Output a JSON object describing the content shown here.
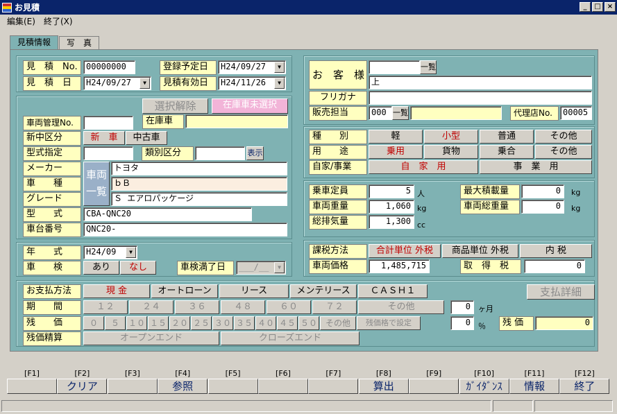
{
  "window": {
    "title": "お見積"
  },
  "menu": [
    "編集(E)",
    "終了(X)"
  ],
  "tabs": [
    "見積情報",
    "写　真"
  ],
  "header": {
    "no_label": "見　積　No.",
    "no_value": "00000000",
    "date_label": "見　積　日",
    "date_value": "H24/09/27",
    "reg_label": "登録予定日",
    "reg_value": "H24/09/27",
    "valid_label": "見積有効日",
    "valid_value": "H24/11/26"
  },
  "customer": {
    "name_label": "お　客　様",
    "name_value": "",
    "name2_value": "上",
    "kana_label": "フリガナ",
    "kana_value": "",
    "staff_label": "販売担当",
    "staff_code": "000",
    "staff_name": "",
    "agent_label": "代理店No.",
    "agent_value": "00005",
    "ichiran": "一覧"
  },
  "vehicle": {
    "clear_btn": "選択解除",
    "stock_btn": "在庫車未選択",
    "stock_label": "在庫車",
    "stock_value": "",
    "mgmt_label": "車両管理No.",
    "mgmt_value": "",
    "newold_label": "新中区分",
    "new_btn": "新　車",
    "used_btn": "中古車",
    "model_label": "型式指定",
    "model_value": "",
    "class_label": "類別区分",
    "class_value": "",
    "show_btn": "表示",
    "maker_label": "メーカー",
    "maker_value": "トヨタ",
    "car_label": "車　　種",
    "car_value": "ｂＢ",
    "grade_label": "グレード",
    "grade_value": "Ｓ エアロパッケージ",
    "type_label": "型　　式",
    "type_value": "CBA-QNC20",
    "frame_label": "車台番号",
    "frame_value": "QNC20-",
    "list_btn": "車両一覧"
  },
  "inspection": {
    "year_label": "年　　式",
    "year_value": "H24/09",
    "shaken_label": "車　　検",
    "ari": "あり",
    "nashi": "なし",
    "expiry_label": "車検満了日",
    "expiry_value": "___/__"
  },
  "category": {
    "kind_label": "種　　別",
    "kinds": [
      "軽",
      "小型",
      "普通",
      "その他"
    ],
    "use_label": "用　　途",
    "uses": [
      "乗用",
      "貨物",
      "乗合",
      "その他"
    ],
    "biz_label": "自家/事業",
    "biz": [
      "自　家　用",
      "事　業　用"
    ]
  },
  "spec": {
    "cap_label": "乗車定員",
    "cap_value": "5",
    "cap_unit": "人",
    "weight_label": "車両重量",
    "weight_value": "1,060",
    "weight_unit": "kg",
    "disp_label": "総排気量",
    "disp_value": "1,300",
    "disp_unit": "cc",
    "maxload_label": "最大積載量",
    "maxload_value": "0",
    "maxload_unit": "kg",
    "gross_label": "車両総重量",
    "gross_value": "0",
    "gross_unit": "kg"
  },
  "tax": {
    "method_label": "課税方法",
    "methods": [
      "合計単位 外税",
      "商品単位 外税",
      "内 税"
    ],
    "price_label": "車両価格",
    "price_value": "1,485,715",
    "acq_label": "取　得　税",
    "acq_value": "0"
  },
  "payment": {
    "method_label": "お支払方法",
    "methods": [
      "現 金",
      "オートローン",
      "リース",
      "メンテリース",
      "ＣＡＳＨ１"
    ],
    "detail_btn": "支払詳細",
    "period_label": "期　　間",
    "periods": [
      "１２",
      "２４",
      "３６",
      "４８",
      "６０",
      "７２",
      "その他"
    ],
    "period_value": "0",
    "period_unit": "ヶ月",
    "residual_label": "残　　価",
    "residuals": [
      "０",
      "５",
      "１０",
      "１５",
      "２０",
      "２５",
      "３０",
      "３５",
      "４０",
      "４５",
      "５０",
      "その他",
      "残価格で設定"
    ],
    "residual_pct": "0",
    "pct_unit": "％",
    "residual_label2": "残 価",
    "residual_value": "0",
    "settle_label": "残価精算",
    "settles": [
      "オープンエンド",
      "クローズエンド"
    ]
  },
  "fkeys": [
    {
      "k": "[F1]",
      "l": ""
    },
    {
      "k": "[F2]",
      "l": "クリア"
    },
    {
      "k": "[F3]",
      "l": ""
    },
    {
      "k": "[F4]",
      "l": "参照"
    },
    {
      "k": "[F5]",
      "l": ""
    },
    {
      "k": "[F6]",
      "l": ""
    },
    {
      "k": "[F7]",
      "l": ""
    },
    {
      "k": "[F8]",
      "l": "算出"
    },
    {
      "k": "[F9]",
      "l": ""
    },
    {
      "k": "[F10]",
      "l": "ｶﾞｲﾀﾞﾝｽ"
    },
    {
      "k": "[F11]",
      "l": "情報"
    },
    {
      "k": "[F12]",
      "l": "終了"
    }
  ]
}
